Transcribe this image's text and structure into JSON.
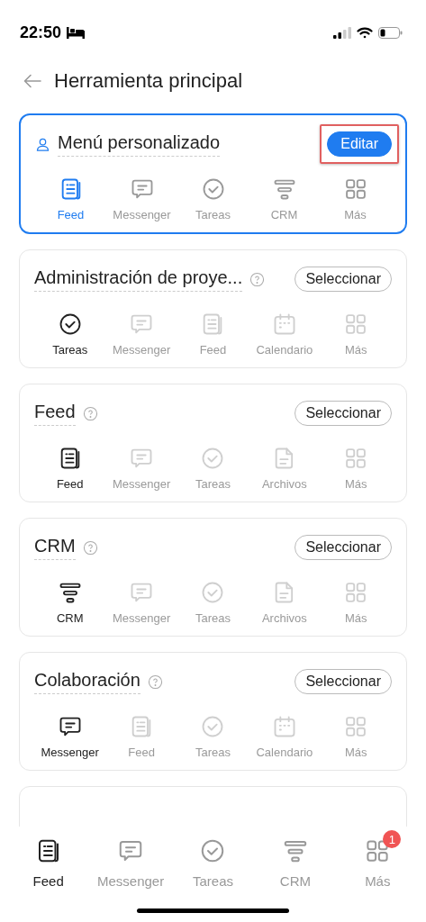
{
  "status_bar": {
    "time": "22:50"
  },
  "header": {
    "title": "Herramienta principal"
  },
  "cards": [
    {
      "kind": "custom",
      "title": "Menú personalizado",
      "selected": true,
      "button": {
        "label": "Editar",
        "highlighted": true
      },
      "items": [
        {
          "kind": "feed",
          "label": "Feed",
          "active": true
        },
        {
          "kind": "messenger",
          "label": "Messenger",
          "active": false
        },
        {
          "kind": "tasks",
          "label": "Tareas",
          "active": false
        },
        {
          "kind": "crm",
          "label": "CRM",
          "active": false
        },
        {
          "kind": "more",
          "label": "Más",
          "active": false
        }
      ]
    },
    {
      "kind": "preset",
      "title": "Administración de proye...",
      "selected": false,
      "button": {
        "label": "Seleccionar"
      },
      "items": [
        {
          "kind": "tasks",
          "label": "Tareas",
          "active": true
        },
        {
          "kind": "messenger",
          "label": "Messenger",
          "active": false
        },
        {
          "kind": "feed",
          "label": "Feed",
          "active": false
        },
        {
          "kind": "calendar",
          "label": "Calendario",
          "active": false
        },
        {
          "kind": "more",
          "label": "Más",
          "active": false
        }
      ]
    },
    {
      "kind": "preset",
      "title": "Feed",
      "selected": false,
      "button": {
        "label": "Seleccionar"
      },
      "items": [
        {
          "kind": "feed",
          "label": "Feed",
          "active": true
        },
        {
          "kind": "messenger",
          "label": "Messenger",
          "active": false
        },
        {
          "kind": "tasks",
          "label": "Tareas",
          "active": false
        },
        {
          "kind": "files",
          "label": "Archivos",
          "active": false
        },
        {
          "kind": "more",
          "label": "Más",
          "active": false
        }
      ]
    },
    {
      "kind": "preset",
      "title": "CRM",
      "selected": false,
      "button": {
        "label": "Seleccionar"
      },
      "items": [
        {
          "kind": "crm",
          "label": "CRM",
          "active": true
        },
        {
          "kind": "messenger",
          "label": "Messenger",
          "active": false
        },
        {
          "kind": "tasks",
          "label": "Tareas",
          "active": false
        },
        {
          "kind": "files",
          "label": "Archivos",
          "active": false
        },
        {
          "kind": "more",
          "label": "Más",
          "active": false
        }
      ]
    },
    {
      "kind": "preset",
      "title": "Colaboración",
      "selected": false,
      "button": {
        "label": "Seleccionar"
      },
      "items": [
        {
          "kind": "messenger",
          "label": "Messenger",
          "active": true
        },
        {
          "kind": "feed",
          "label": "Feed",
          "active": false
        },
        {
          "kind": "tasks",
          "label": "Tareas",
          "active": false
        },
        {
          "kind": "calendar",
          "label": "Calendario",
          "active": false
        },
        {
          "kind": "more",
          "label": "Más",
          "active": false
        }
      ]
    },
    {
      "kind": "cut_off"
    }
  ],
  "tab_bar": [
    {
      "kind": "feed",
      "label": "Feed",
      "selected": true
    },
    {
      "kind": "messenger",
      "label": "Messenger",
      "selected": false
    },
    {
      "kind": "tasks",
      "label": "Tareas",
      "selected": false
    },
    {
      "kind": "crm",
      "label": "CRM",
      "selected": false
    },
    {
      "kind": "more",
      "label": "Más",
      "selected": false,
      "badge": "1"
    }
  ]
}
